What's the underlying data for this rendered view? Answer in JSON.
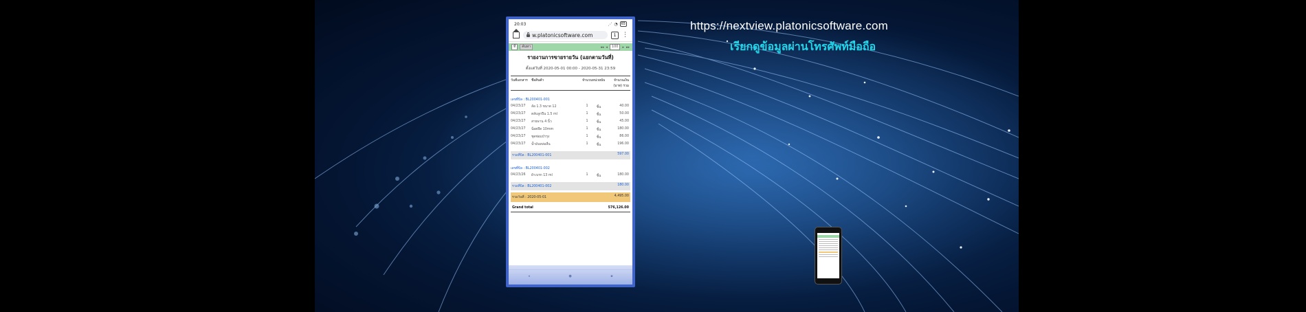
{
  "overlay": {
    "url": "https://nextview.platonicsoftware.com",
    "thai_caption": "เรียกดูข้อมูลผ่านโทรศัพท์มือถือ"
  },
  "phone": {
    "status_time": "20:03",
    "status_battery": "65",
    "address_bar": "w.platonicsoftware.com",
    "tab_count": "1",
    "toolbar": {
      "select_value": "ที่",
      "button_label": "ค้นหา",
      "zoom": "100"
    },
    "report": {
      "title": "รายงานการขายรายวัน (แยกตามวันที่)",
      "subtitle": "ตั้งแต่วันที่ 2020-05-01 00:00 - 2020-05-31 23:59",
      "columns": [
        "วันที่เอกสาร",
        "ชื่อสินค้า",
        "จำนวน",
        "หน่วยนับ",
        "จำนวนเงิน (บาท) รวม"
      ],
      "groups": [
        {
          "label": "เลขที่บิล : BL200401-001",
          "rows": [
            {
              "date": "04/23/27",
              "item": "ล้อ 1.3 ขนาด 12",
              "qty": "1",
              "unit": "ชิ้น",
              "amount": "40.00"
            },
            {
              "date": "04/23/27",
              "item": "ตลับลูกปืน 1.5 ml",
              "qty": "1",
              "unit": "ชิ้น",
              "amount": "50.00"
            },
            {
              "date": "04/23/27",
              "item": "สายพาน 4 นิ้ว",
              "qty": "1",
              "unit": "ชิ้น",
              "amount": "45.00"
            },
            {
              "date": "04/23/27",
              "item": "น็อตยึด 10mm",
              "qty": "1",
              "unit": "ชิ้น",
              "amount": "180.00"
            },
            {
              "date": "04/23/27",
              "item": "ชุดซ่อมบำรุง",
              "qty": "1",
              "unit": "ชิ้น",
              "amount": "86.00"
            },
            {
              "date": "04/23/27",
              "item": "น้ำมันหล่อลื่น",
              "qty": "1",
              "unit": "ชิ้น",
              "amount": "196.00"
            }
          ],
          "subtotal_label": "รวมที่บิล : BL200401-001",
          "subtotal_value": "597.00"
        },
        {
          "label": "เลขที่บิล : BL200401-002",
          "rows": [
            {
              "date": "04/23/26",
              "item": "ผ้าเบรก 13 ml",
              "qty": "1",
              "unit": "ชิ้น",
              "amount": "180.00"
            }
          ],
          "subtotal_label": "รวมที่บิล : BL200401-002",
          "subtotal_value": "180.00"
        }
      ],
      "total_label": "รวมวันที่ : 2020-05-01",
      "total_value": "4,495.00",
      "grand_label": "Grand total",
      "grand_value": "576,126.00"
    }
  }
}
